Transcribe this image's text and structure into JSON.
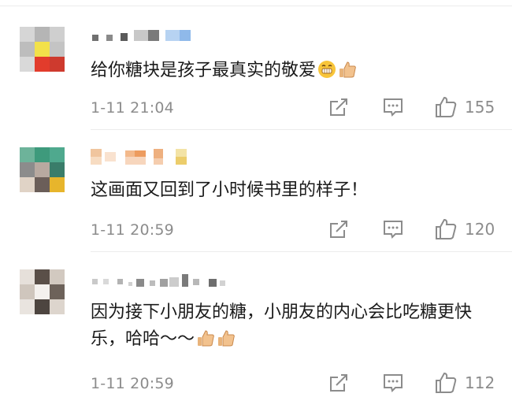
{
  "comments": [
    {
      "username": "",
      "text": "给你糖块是孩子最真实的敬爱",
      "emojis": [
        "grinning-face-emoji",
        "thumbs-up-emoji"
      ],
      "time": "1-11 21:04",
      "likes": "155"
    },
    {
      "username": "",
      "text": "这画面又回到了小时候书里的样子！",
      "emojis": [],
      "time": "1-11 20:59",
      "likes": "120"
    },
    {
      "username": "",
      "text": "因为接下小朋友的糖，小朋友的内心会比吃糖更快乐，哈哈～～",
      "emojis": [
        "thumbs-up-emoji",
        "thumbs-up-emoji"
      ],
      "time": "1-11 20:59",
      "likes": "112"
    }
  ],
  "icons": {
    "share": "share-icon",
    "reply": "comment-icon",
    "like": "thumbs-up-icon"
  },
  "colors": {
    "text": "#1a1a1a",
    "meta": "#8c8c8c",
    "icon": "#8c8c8c",
    "divider": "#ececec"
  }
}
